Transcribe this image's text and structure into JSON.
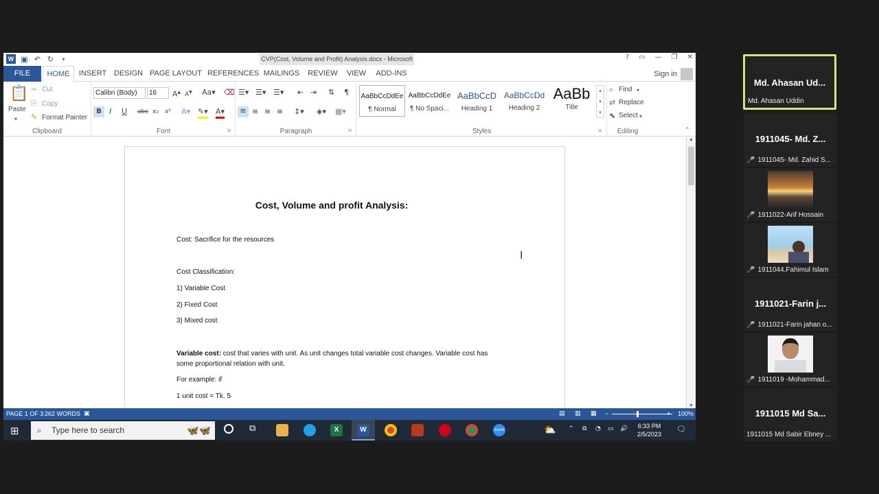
{
  "word": {
    "window_title": "CVP(Cost, Volume and Profit) Analysis.docx - Microsoft Word",
    "window_buttons": [
      "?",
      "▭",
      "—",
      "❐",
      "✕"
    ],
    "tabs": [
      "FILE",
      "HOME",
      "INSERT",
      "DESIGN",
      "PAGE LAYOUT",
      "REFERENCES",
      "MAILINGS",
      "REVIEW",
      "VIEW",
      "ADD-INS"
    ],
    "active_tab": "HOME",
    "sign_in": "Sign in",
    "ribbon": {
      "clipboard": {
        "paste": "Paste",
        "cut": "Cut",
        "copy": "Copy",
        "format_painter": "Format Painter",
        "label": "Clipboard"
      },
      "font": {
        "font_name": "Calibri (Body)",
        "font_size": "16",
        "bold": "B",
        "italic": "I",
        "underline": "U",
        "strike": "abc",
        "sub": "x₂",
        "sup": "x²",
        "label": "Font"
      },
      "paragraph": {
        "label": "Paragraph"
      },
      "styles": {
        "items": [
          {
            "sample": "AaBbCcDdEe",
            "name": "¶ Normal"
          },
          {
            "sample": "AaBbCcDdEe",
            "name": "¶ No Spaci..."
          },
          {
            "sample": "AaBbCcD",
            "name": "Heading 1"
          },
          {
            "sample": "AaBbCcDd",
            "name": "Heading 2"
          },
          {
            "sample": "AaBb",
            "name": "Title"
          }
        ],
        "label": "Styles"
      },
      "editing": {
        "find": "Find",
        "replace": "Replace",
        "select": "Select",
        "label": "Editing"
      }
    },
    "document": {
      "title": "Cost, Volume and profit Analysis:",
      "line1": "Cost: Sacrifice for the resources",
      "line2": "Cost Classification:",
      "line3": "1) Variable Cost",
      "line4": "2) Fixed Cost",
      "line5": "3) Mixed cost",
      "var_bold": "Variable cost:",
      "var_text1": " cost that varies with unit. As unit changes total variable cost changes. Variable cost has",
      "var_text2": "some proportional relation with unit.",
      "example": "For example: if",
      "unit_cost": "1 unit cost = Tk. 5"
    },
    "status": {
      "page": "PAGE 1 OF 3",
      "words": "262 WORDS",
      "zoom": "100%"
    },
    "taskbar": {
      "search_placeholder": "Type here to search",
      "time": "6:33 PM",
      "date": "2/5/2023"
    }
  },
  "participants": [
    {
      "title": "Md. Ahasan Ud...",
      "label": "Md. Ahasan Uddin",
      "active": true,
      "muted": false,
      "video": false
    },
    {
      "title": "1911045- Md. Z...",
      "label": "1911045- Md. Zahid S...",
      "active": false,
      "muted": true,
      "video": false
    },
    {
      "title": "",
      "label": "1911022-Arif Hossain",
      "active": false,
      "muted": true,
      "video": true
    },
    {
      "title": "",
      "label": "1911044.Fahimul Islam",
      "active": false,
      "muted": true,
      "video": true
    },
    {
      "title": "1911021-Farin j...",
      "label": "1911021-Farin jahan o...",
      "active": false,
      "muted": true,
      "video": false
    },
    {
      "title": "",
      "label": "1911019 -Mohammad...",
      "active": false,
      "muted": true,
      "video": true
    },
    {
      "title": "1911015 Md Sa...",
      "label": "1911015 Md Sabir Ebney ...",
      "active": false,
      "muted": false,
      "video": false
    }
  ],
  "colors": {
    "word_blue": "#2b579a",
    "active_speaker": "#d7e57a",
    "muted_red": "#e04040"
  }
}
